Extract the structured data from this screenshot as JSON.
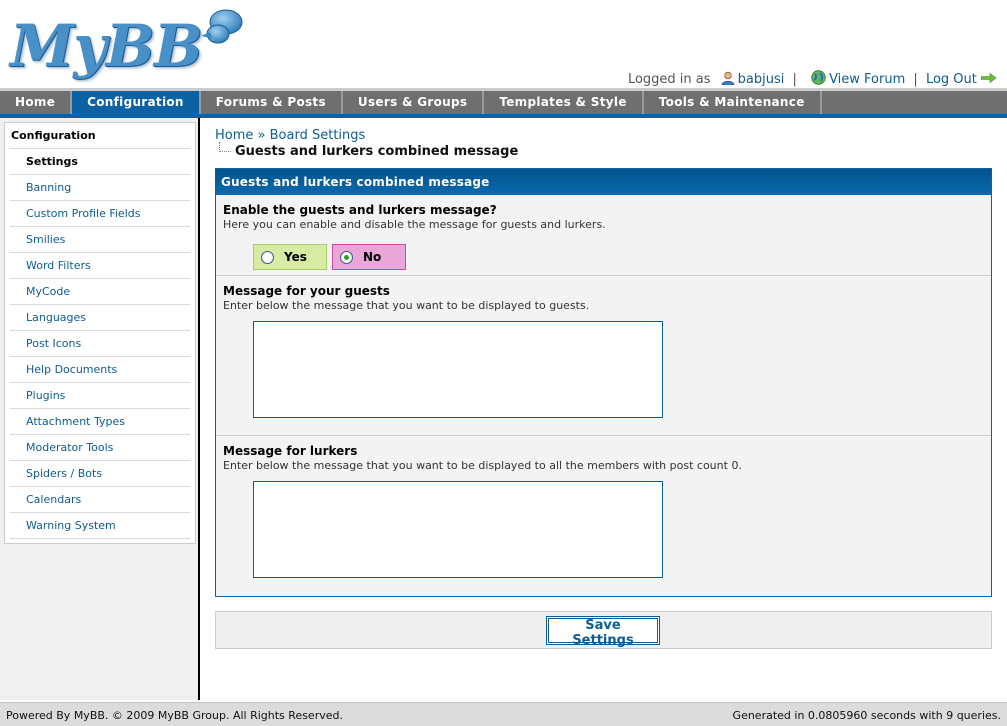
{
  "header": {
    "logo_text": "MyBB",
    "logged_in_label": "Logged in as",
    "username": "babjusi",
    "view_forum": "View Forum",
    "logout": "Log Out",
    "separator": "|"
  },
  "nav": {
    "tabs": [
      {
        "label": "Home",
        "active": false
      },
      {
        "label": "Configuration",
        "active": true
      },
      {
        "label": "Forums & Posts",
        "active": false
      },
      {
        "label": "Users & Groups",
        "active": false
      },
      {
        "label": "Templates & Style",
        "active": false
      },
      {
        "label": "Tools & Maintenance",
        "active": false
      }
    ]
  },
  "sidebar": {
    "title": "Configuration",
    "items": [
      {
        "label": "Settings",
        "active": true
      },
      {
        "label": "Banning"
      },
      {
        "label": "Custom Profile Fields"
      },
      {
        "label": "Smilies"
      },
      {
        "label": "Word Filters"
      },
      {
        "label": "MyCode"
      },
      {
        "label": "Languages"
      },
      {
        "label": "Post Icons"
      },
      {
        "label": "Help Documents"
      },
      {
        "label": "Plugins"
      },
      {
        "label": "Attachment Types"
      },
      {
        "label": "Moderator Tools"
      },
      {
        "label": "Spiders / Bots"
      },
      {
        "label": "Calendars"
      },
      {
        "label": "Warning System"
      }
    ]
  },
  "breadcrumb": {
    "home": "Home",
    "separator": "»",
    "board_settings": "Board Settings",
    "current": "Guests and lurkers combined message"
  },
  "panel": {
    "title": "Guests and lurkers combined message",
    "enable": {
      "label": "Enable the guests and lurkers message?",
      "description": "Here you can enable and disable the message for guests and lurkers.",
      "yes_label": "Yes",
      "no_label": "No",
      "selected": "No"
    },
    "guests": {
      "label": "Message for your guests",
      "description": "Enter below the message that you want to be displayed to guests.",
      "value": ""
    },
    "lurkers": {
      "label": "Message for lurkers",
      "description": "Enter below the message that you want to be displayed to all the members with post count 0.",
      "value": ""
    }
  },
  "buttons": {
    "save": "Save Settings"
  },
  "footer": {
    "left": "Powered By MyBB. © 2009 MyBB Group. All Rights Reserved.",
    "right": "Generated in 0.0805960 seconds with 9 queries."
  }
}
